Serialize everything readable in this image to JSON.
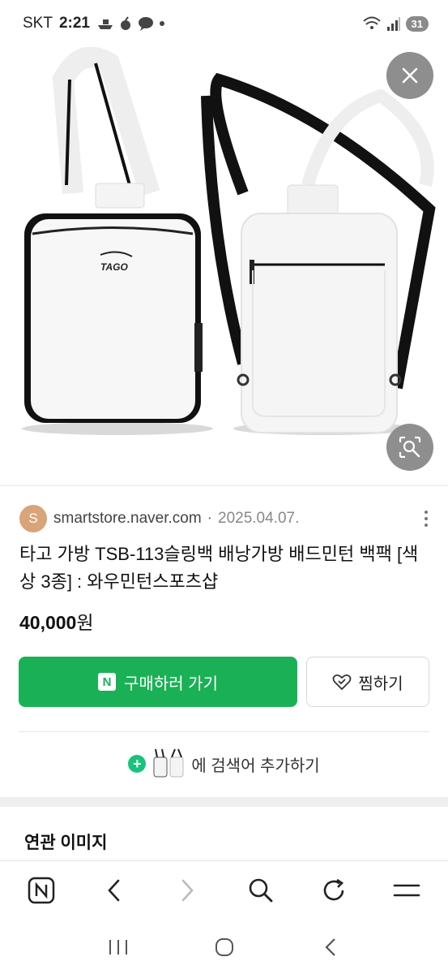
{
  "status_bar": {
    "carrier": "SKT",
    "time": "2:21",
    "battery": "31"
  },
  "product": {
    "image_brand_mark": "TAGO",
    "source_initial": "S",
    "source_domain": "smartstore.naver.com",
    "source_separator": "·",
    "date": "2025.04.07.",
    "title": "타고 가방 TSB-113슬링백 배낭가방 배드민턴 백팩 [색상 3종] : 와우민턴스포츠샵",
    "price": "40,000",
    "price_unit": "원"
  },
  "actions": {
    "buy_badge": "N",
    "buy_label": "구매하러 가기",
    "wish_label": "찜하기",
    "add_search_label": "에 검색어 추가하기"
  },
  "related": {
    "title": "연관 이미지"
  },
  "colors": {
    "accent_green": "#1ab156",
    "plus_green": "#19c37d",
    "overlay_gray": "#8e8e8e"
  },
  "icons": {
    "close": "close-icon",
    "lens": "image-search-icon",
    "more": "more-vertical-icon",
    "heart": "heart-icon",
    "plus": "plus-circle-icon",
    "browser": [
      "naver-home-icon",
      "back-icon",
      "forward-icon",
      "search-icon",
      "refresh-icon",
      "menu-icon"
    ],
    "system": [
      "recent-apps-icon",
      "home-icon",
      "back-icon"
    ]
  }
}
